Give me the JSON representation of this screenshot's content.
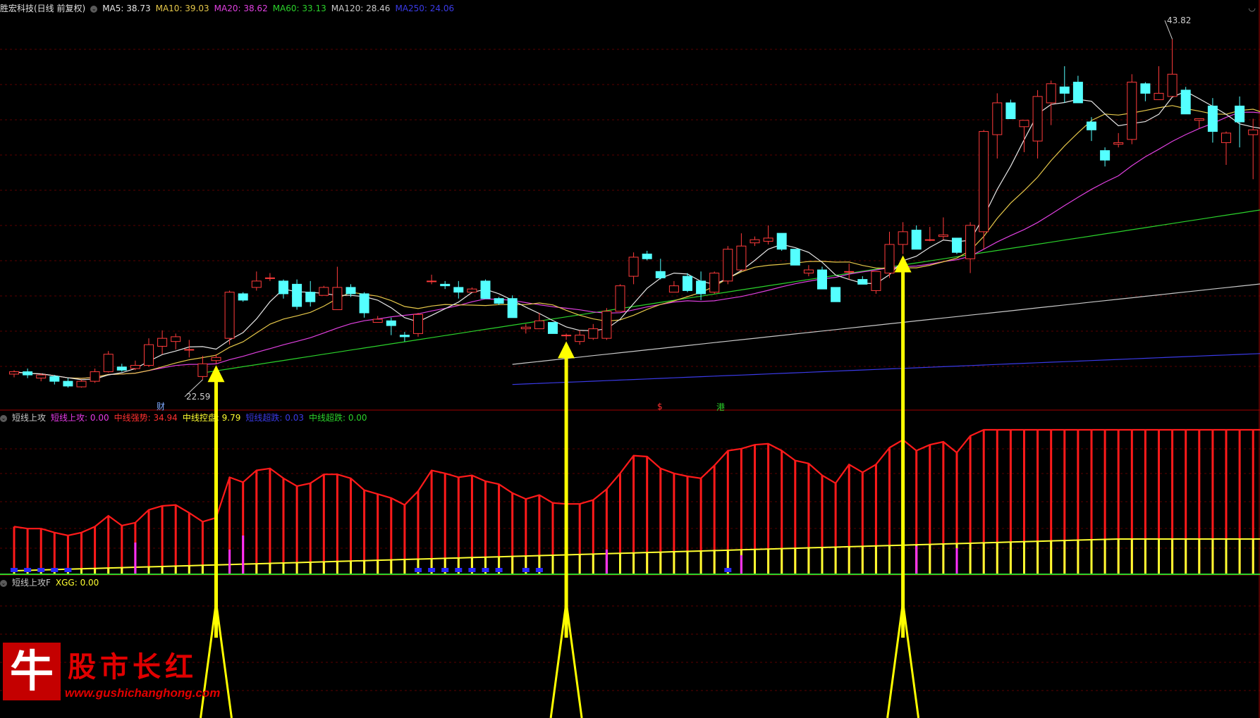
{
  "main_header": {
    "title": "胜宏科技(日线 前复权)",
    "toggle_icon": "chevron-circle-icon",
    "indicators": [
      {
        "label": "MA5: 38.73",
        "color": "#e6e6e6"
      },
      {
        "label": "MA10: 39.03",
        "color": "#e6c84a"
      },
      {
        "label": "MA20: 38.62",
        "color": "#e040e0"
      },
      {
        "label": "MA60: 33.13",
        "color": "#2bd22b"
      },
      {
        "label": "MA120: 28.46",
        "color": "#c8c8c8"
      },
      {
        "label": "MA250: 24.06",
        "color": "#3a3ae6"
      }
    ]
  },
  "sub1_header": {
    "title": "短线上攻",
    "indicators": [
      {
        "label": "短线上攻: 0.00",
        "color": "#e63ae6"
      },
      {
        "label": "中线强势: 34.94",
        "color": "#ff3030"
      },
      {
        "label": "中线控盘: 9.79",
        "color": "#ffff30"
      },
      {
        "label": "短线超跌: 0.03",
        "color": "#3a3ae6"
      },
      {
        "label": "中线超跌: 0.00",
        "color": "#2bd22b"
      }
    ]
  },
  "sub2_header": {
    "title": "短线上攻F",
    "indicators": [
      {
        "label": "XGG: 0.00",
        "color": "#ffff30"
      }
    ]
  },
  "annotations": {
    "high_label": "43.82",
    "low_label": "22.59",
    "marker_cai": "财",
    "marker_s": "$",
    "marker_gang": "港"
  },
  "logo": {
    "glyph": "牛",
    "name": "股市长红",
    "url": "www.gushichanghong.com"
  },
  "chart_data": {
    "type": "candlestick",
    "price_range": [
      20.8,
      45.2
    ],
    "candles": [
      [
        22.75,
        23.0,
        22.55,
        22.9
      ],
      [
        22.9,
        23.1,
        22.5,
        22.7
      ],
      [
        22.5,
        22.8,
        22.3,
        22.7
      ],
      [
        22.6,
        22.7,
        22.1,
        22.3
      ],
      [
        22.3,
        22.5,
        21.9,
        22.0
      ],
      [
        21.95,
        22.4,
        21.9,
        22.3
      ],
      [
        22.3,
        23.1,
        22.2,
        22.9
      ],
      [
        22.9,
        24.2,
        22.85,
        24.0
      ],
      [
        23.2,
        23.4,
        22.9,
        23.0
      ],
      [
        23.1,
        23.6,
        23.0,
        23.3
      ],
      [
        23.3,
        25.0,
        23.2,
        24.6
      ],
      [
        24.5,
        25.5,
        24.0,
        25.0
      ],
      [
        24.8,
        25.3,
        24.3,
        25.1
      ],
      [
        24.3,
        24.9,
        23.8,
        24.3
      ],
      [
        22.6,
        23.9,
        22.4,
        23.4
      ],
      [
        23.6,
        24.0,
        23.4,
        23.8
      ],
      [
        25.0,
        28.0,
        24.6,
        27.9
      ],
      [
        27.8,
        27.9,
        27.3,
        27.4
      ],
      [
        28.2,
        29.2,
        28.0,
        28.6
      ],
      [
        28.8,
        29.1,
        28.6,
        28.8
      ],
      [
        28.6,
        28.7,
        27.5,
        27.8
      ],
      [
        28.4,
        28.7,
        26.8,
        27.0
      ],
      [
        27.9,
        28.6,
        27.0,
        27.3
      ],
      [
        27.7,
        28.3,
        27.7,
        28.2
      ],
      [
        26.8,
        29.5,
        26.8,
        28.2
      ],
      [
        28.2,
        28.4,
        27.6,
        27.8
      ],
      [
        27.8,
        27.9,
        26.3,
        26.6
      ],
      [
        26.0,
        26.4,
        26.0,
        26.2
      ],
      [
        26.1,
        26.3,
        25.2,
        25.8
      ],
      [
        25.2,
        25.4,
        24.8,
        25.1
      ],
      [
        25.3,
        26.6,
        25.1,
        26.5
      ],
      [
        28.6,
        29.0,
        28.4,
        28.6
      ],
      [
        28.4,
        28.6,
        28.1,
        28.3
      ],
      [
        28.2,
        28.6,
        27.5,
        27.9
      ],
      [
        27.9,
        28.2,
        28.0,
        28.1
      ],
      [
        28.6,
        28.7,
        27.5,
        27.5
      ],
      [
        27.5,
        27.6,
        27.1,
        27.2
      ],
      [
        27.5,
        27.7,
        26.3,
        26.3
      ],
      [
        25.6,
        25.9,
        25.3,
        25.7
      ],
      [
        25.6,
        26.6,
        25.6,
        26.1
      ],
      [
        26.0,
        26.0,
        25.3,
        25.3
      ],
      [
        25.2,
        25.3,
        24.9,
        25.2
      ],
      [
        24.8,
        25.5,
        24.6,
        25.2
      ],
      [
        25.0,
        25.9,
        24.9,
        25.6
      ],
      [
        25.0,
        26.9,
        24.9,
        26.7
      ],
      [
        26.7,
        28.4,
        26.7,
        28.3
      ],
      [
        28.9,
        30.4,
        28.4,
        30.1
      ],
      [
        30.3,
        30.5,
        29.9,
        30.0
      ],
      [
        29.2,
        30.0,
        28.7,
        28.8
      ],
      [
        27.9,
        28.6,
        27.9,
        28.3
      ],
      [
        28.9,
        29.1,
        27.9,
        28.0
      ],
      [
        28.6,
        29.2,
        27.4,
        27.8
      ],
      [
        27.9,
        29.2,
        27.8,
        29.1
      ],
      [
        28.6,
        30.8,
        28.4,
        30.6
      ],
      [
        29.3,
        31.6,
        29.3,
        30.8
      ],
      [
        31.0,
        31.4,
        30.8,
        31.2
      ],
      [
        31.1,
        32.1,
        30.9,
        31.3
      ],
      [
        31.6,
        31.6,
        30.5,
        30.6
      ],
      [
        30.6,
        30.6,
        29.6,
        29.6
      ],
      [
        29.1,
        29.6,
        28.9,
        29.3
      ],
      [
        29.3,
        29.5,
        28.1,
        28.1
      ],
      [
        28.2,
        28.2,
        27.3,
        27.3
      ],
      [
        29.2,
        29.7,
        28.7,
        29.2
      ],
      [
        28.7,
        28.9,
        28.4,
        28.4
      ],
      [
        28.0,
        29.2,
        27.8,
        29.2
      ],
      [
        29.1,
        31.7,
        28.8,
        30.9
      ],
      [
        30.9,
        32.3,
        30.3,
        31.7
      ],
      [
        31.8,
        32.1,
        30.6,
        30.6
      ],
      [
        31.2,
        32.0,
        31.1,
        31.2
      ],
      [
        31.4,
        32.6,
        31.2,
        31.5
      ],
      [
        31.3,
        31.3,
        30.3,
        30.4
      ],
      [
        30.0,
        32.3,
        29.1,
        32.1
      ],
      [
        31.7,
        38.1,
        30.6,
        38.0
      ],
      [
        37.8,
        40.4,
        36.3,
        39.8
      ],
      [
        39.8,
        40.0,
        38.8,
        38.8
      ],
      [
        38.3,
        38.7,
        36.7,
        38.7
      ],
      [
        37.4,
        40.6,
        36.3,
        40.2
      ],
      [
        39.8,
        41.2,
        38.4,
        41.0
      ],
      [
        40.8,
        42.1,
        39.8,
        40.4
      ],
      [
        41.1,
        41.5,
        39.8,
        39.8
      ],
      [
        38.6,
        38.9,
        37.4,
        38.1
      ],
      [
        36.8,
        37.0,
        35.8,
        36.2
      ],
      [
        37.2,
        37.9,
        37.0,
        37.3
      ],
      [
        37.5,
        41.6,
        37.2,
        41.1
      ],
      [
        41.0,
        41.1,
        39.9,
        40.4
      ],
      [
        40.0,
        42.1,
        40.0,
        40.4
      ],
      [
        40.2,
        43.8,
        40.2,
        41.6
      ],
      [
        40.6,
        40.8,
        39.1,
        39.1
      ],
      [
        38.7,
        38.8,
        38.2,
        38.8
      ],
      [
        39.6,
        40.1,
        37.3,
        38.0
      ],
      [
        37.3,
        38.0,
        35.9,
        37.9
      ],
      [
        39.6,
        40.2,
        37.0,
        38.6
      ],
      [
        37.8,
        38.8,
        35.0,
        38.1
      ],
      [
        39.6,
        40.2,
        37.7,
        38.1
      ]
    ],
    "xgg_signals": [
      15,
      41,
      66
    ]
  }
}
